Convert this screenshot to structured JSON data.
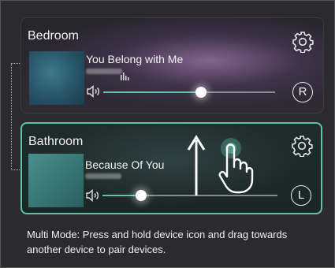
{
  "devices": [
    {
      "room": "Bedroom",
      "song": "You Belong with Me",
      "volume": 0.57,
      "channel": "R",
      "selected": false
    },
    {
      "room": "Bathroom",
      "song": "Because Of You",
      "volume": 0.22,
      "channel": "L",
      "selected": true
    }
  ],
  "instruction": "Multi Mode: Press and hold device icon and drag towards another device to pair devices.",
  "colors": {
    "accent": "#5fc2a8",
    "background": "#2b2b2e",
    "text": "#ffffff"
  },
  "icons": [
    "gear-icon",
    "speaker-icon",
    "equalizer-icon",
    "drag-up-arrow-icon",
    "pointing-hand-icon"
  ]
}
